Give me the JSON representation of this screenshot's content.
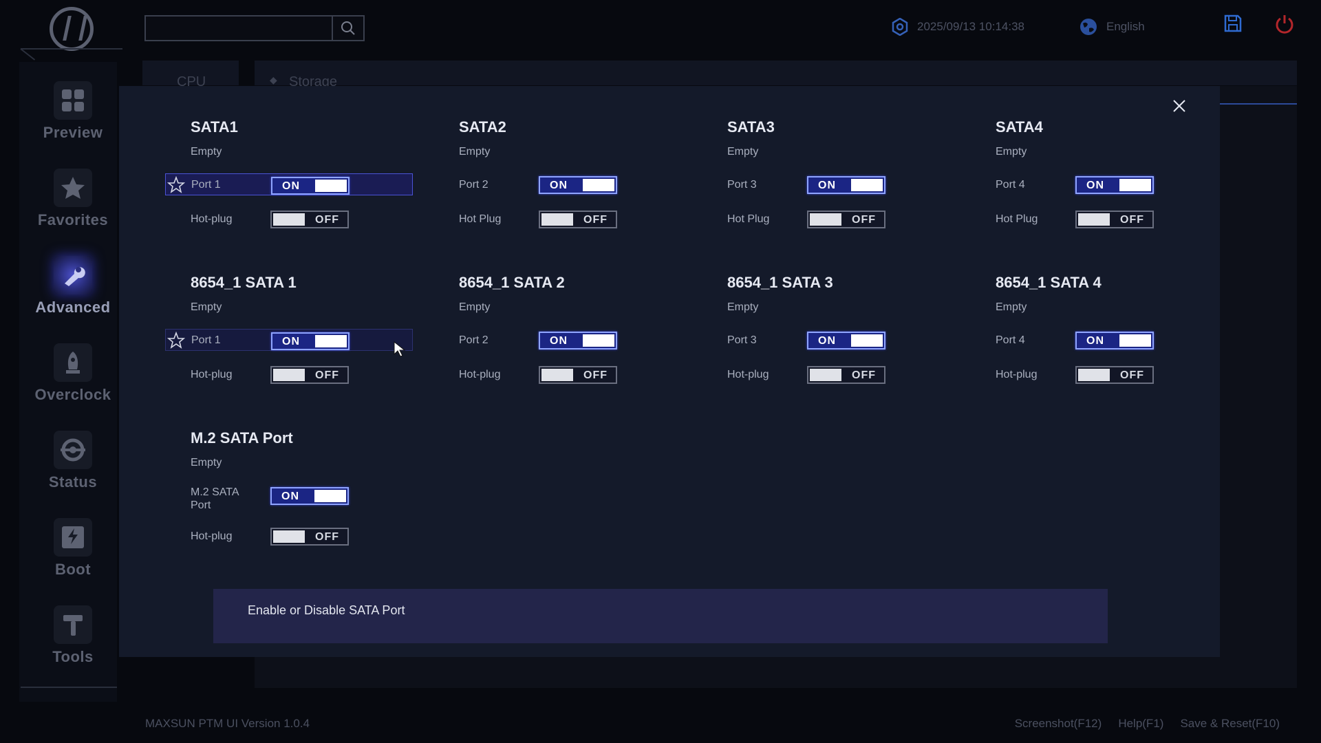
{
  "app": {
    "version_text": "MAXSUN PTM UI Version 1.0.4"
  },
  "header": {
    "datetime": "2025/09/13 10:14:38",
    "language": "English"
  },
  "sidebar": {
    "items": [
      {
        "label": "Preview",
        "icon": "grid-icon"
      },
      {
        "label": "Favorites",
        "icon": "star-icon"
      },
      {
        "label": "Advanced",
        "icon": "wrench-icon",
        "active": true
      },
      {
        "label": "Overclock",
        "icon": "rocket-icon"
      },
      {
        "label": "Status",
        "icon": "status-icon"
      },
      {
        "label": "Boot",
        "icon": "ssd-icon"
      },
      {
        "label": "Tools",
        "icon": "tools-icon"
      }
    ]
  },
  "tabs": [
    {
      "label": "CPU"
    },
    {
      "label": "Storage"
    }
  ],
  "groups": [
    {
      "title": "SATA1",
      "status": "Empty",
      "port_label": "Port 1",
      "port_state": "ON",
      "hotplug_label": "Hot-plug",
      "hotplug_state": "OFF"
    },
    {
      "title": "SATA2",
      "status": "Empty",
      "port_label": "Port 2",
      "port_state": "ON",
      "hotplug_label": "Hot Plug",
      "hotplug_state": "OFF"
    },
    {
      "title": "SATA3",
      "status": "Empty",
      "port_label": "Port 3",
      "port_state": "ON",
      "hotplug_label": "Hot Plug",
      "hotplug_state": "OFF"
    },
    {
      "title": "SATA4",
      "status": "Empty",
      "port_label": "Port 4",
      "port_state": "ON",
      "hotplug_label": "Hot Plug",
      "hotplug_state": "OFF"
    },
    {
      "title": "8654_1 SATA 1",
      "status": "Empty",
      "port_label": "Port 1",
      "port_state": "ON",
      "hotplug_label": "Hot-plug",
      "hotplug_state": "OFF"
    },
    {
      "title": "8654_1 SATA 2",
      "status": "Empty",
      "port_label": "Port 2",
      "port_state": "ON",
      "hotplug_label": "Hot-plug",
      "hotplug_state": "OFF"
    },
    {
      "title": "8654_1 SATA 3",
      "status": "Empty",
      "port_label": "Port 3",
      "port_state": "ON",
      "hotplug_label": "Hot-plug",
      "hotplug_state": "OFF"
    },
    {
      "title": "8654_1 SATA 4",
      "status": "Empty",
      "port_label": "Port 4",
      "port_state": "ON",
      "hotplug_label": "Hot-plug",
      "hotplug_state": "OFF"
    },
    {
      "title": "M.2 SATA Port",
      "status": "Empty",
      "port_label": "M.2 SATA Port",
      "port_state": "ON",
      "hotplug_label": "Hot-plug",
      "hotplug_state": "OFF"
    }
  ],
  "description": "Enable or Disable SATA Port",
  "footer": {
    "screenshot": "Screenshot(F12)",
    "help": "Help(F1)",
    "save_reset": "Save & Reset(F10)"
  },
  "colors": {
    "accent": "#1b2584",
    "selection": "#1a1c54",
    "power": "#b3262b",
    "save": "#2f6bd1"
  }
}
